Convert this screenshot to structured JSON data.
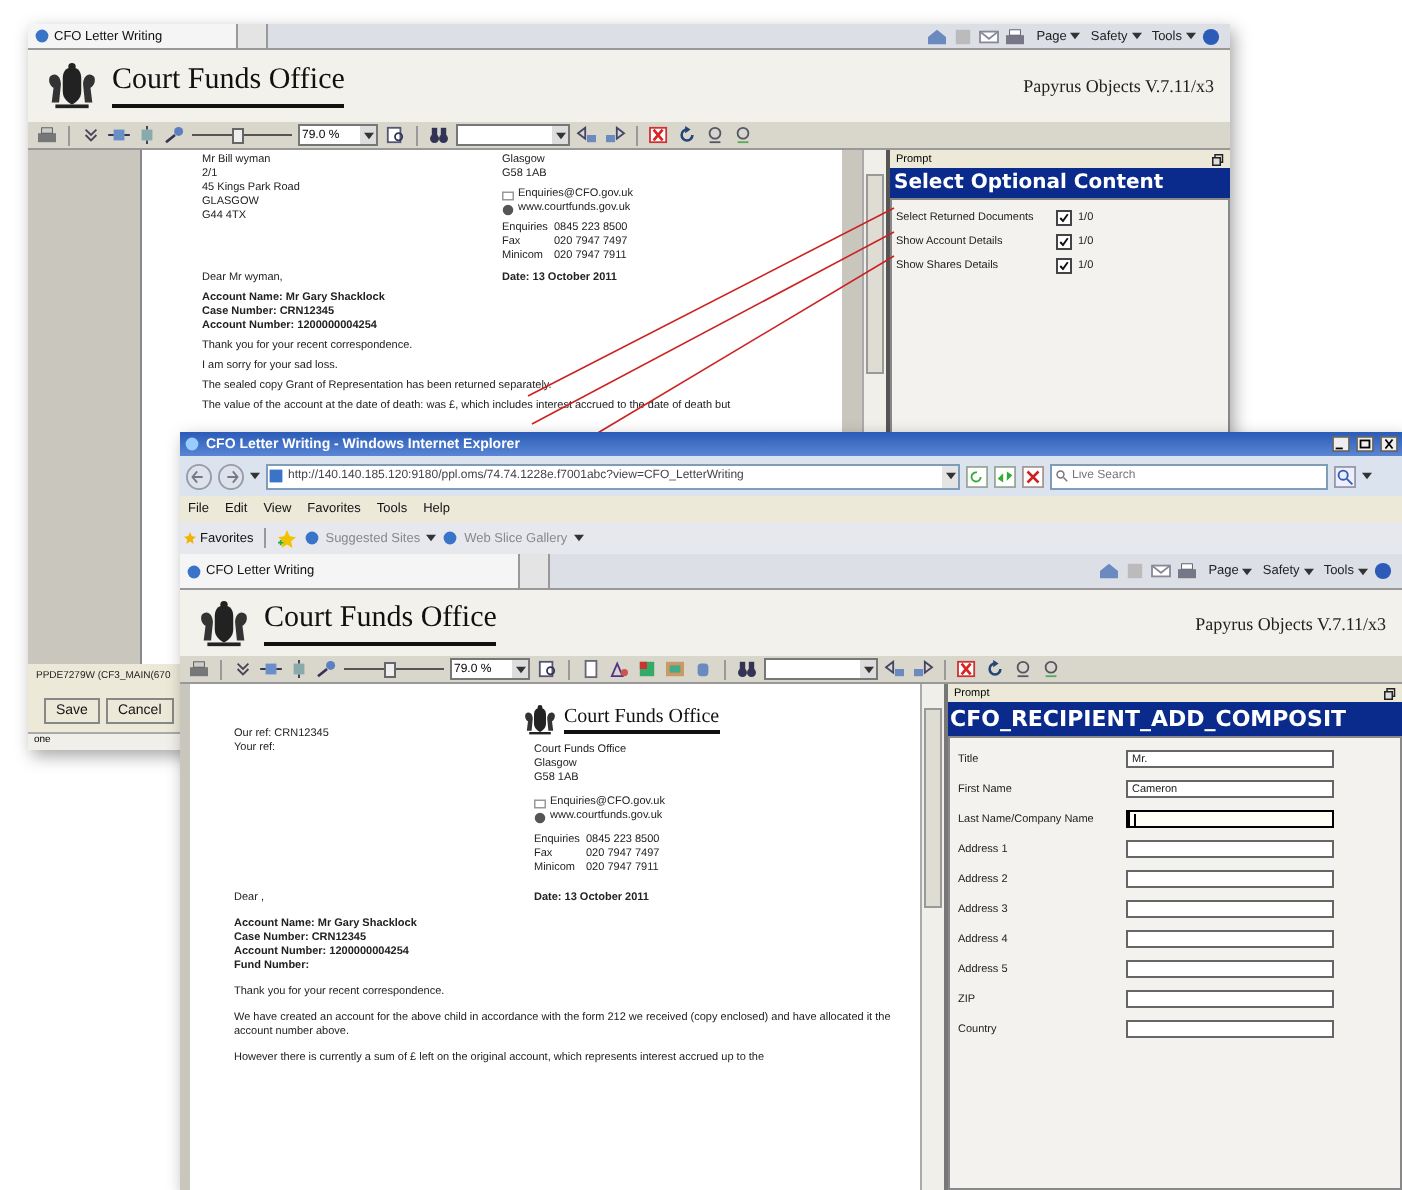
{
  "back_window": {
    "tab": "CFO Letter Writing",
    "command_bar": [
      "Page",
      "Safety",
      "Tools"
    ],
    "header": {
      "logo_text": "Court Funds Office",
      "version": "Papyrus Objects V.7.11/x3"
    },
    "toolbar": {
      "zoom": "79.0 %",
      "level": 0.45
    },
    "letter": {
      "recipient": [
        "Mr Bill wyman",
        "2/1",
        "45 Kings Park Road",
        "GLASGOW",
        "G44 4TX"
      ],
      "address": [
        "Glasgow",
        "G58 1AB"
      ],
      "email": "Enquiries@CFO.gov.uk",
      "web": "www.courtfunds.gov.uk",
      "contacts": [
        {
          "label": "Enquiries",
          "value": "0845 223 8500"
        },
        {
          "label": "Fax",
          "value": "020 7947 7497"
        },
        {
          "label": "Minicom",
          "value": "020 7947 7911"
        }
      ],
      "salutation": "Dear Mr wyman,",
      "date": "Date: 13 October 2011",
      "account_lines": [
        "Account Name: Mr Gary Shacklock",
        "Case Number: CRN12345",
        "Account Number: 1200000004254"
      ],
      "paragraphs": [
        "Thank you for your recent correspondence.",
        "I am sorry for your sad loss.",
        "The sealed copy Grant of Representation has been returned separately.",
        "The value of the account at the date of death: was £, which includes interest accrued to the date of death but"
      ]
    },
    "prompt": {
      "title": "Prompt",
      "heading": "Select Optional Content",
      "options": [
        {
          "label": "Select Returned Documents",
          "checked": true,
          "value": "1/0"
        },
        {
          "label": "Show Account Details",
          "checked": true,
          "value": "1/0"
        },
        {
          "label": "Show Shares Details",
          "checked": true,
          "value": "1/0"
        }
      ]
    },
    "status_text": "PPDE7279W (CF3_MAIN(670",
    "buttons": [
      "Save",
      "Cancel"
    ],
    "status_bar": "one"
  },
  "front_window": {
    "title": "CFO Letter Writing - Windows Internet Explorer",
    "address": "http://140.140.185.120:9180/ppl.oms/74.74.1228e.f7001abc?view=CFO_LetterWriting",
    "search_placeholder": "Live Search",
    "menu": [
      "File",
      "Edit",
      "View",
      "Favorites",
      "Tools",
      "Help"
    ],
    "favorites": {
      "label": "Favorites",
      "links": [
        "Suggested Sites",
        "Web Slice Gallery"
      ]
    },
    "tab": "CFO Letter Writing",
    "command_bar": [
      "Page",
      "Safety",
      "Tools"
    ],
    "header": {
      "logo_text": "Court Funds Office",
      "version": "Papyrus Objects V.7.11/x3"
    },
    "toolbar": {
      "zoom": "79.0 %",
      "level": 0.45
    },
    "letter": {
      "refs": [
        "Our ref: CRN12345",
        "Your ref:"
      ],
      "logo_text": "Court Funds Office",
      "address": [
        "Court Funds Office",
        "Glasgow",
        "G58 1AB"
      ],
      "email": "Enquiries@CFO.gov.uk",
      "web": "www.courtfunds.gov.uk",
      "contacts": [
        {
          "label": "Enquiries",
          "value": "0845 223 8500"
        },
        {
          "label": "Fax",
          "value": "020 7947 7497"
        },
        {
          "label": "Minicom",
          "value": "020 7947 7911"
        }
      ],
      "salutation": "Dear ,",
      "date": "Date: 13 October 2011",
      "account_lines": [
        "Account Name: Mr Gary Shacklock",
        "Case Number: CRN12345",
        "Account Number: 1200000004254",
        "Fund Number:"
      ],
      "paragraphs": [
        "Thank you for your recent correspondence.",
        "We have created an account for the above child in accordance with the form 212 we received (copy enclosed) and have allocated it the account number above.",
        "However there is currently a sum of £ left on the original account, which represents interest accrued up to the"
      ]
    },
    "prompt": {
      "title": "Prompt",
      "heading": "CFO_RECIPIENT_ADD_COMPOSIT",
      "fields": [
        {
          "label": "Title",
          "value": "Mr.",
          "focused": false
        },
        {
          "label": "First Name",
          "value": "Cameron",
          "focused": false
        },
        {
          "label": "Last Name/Company Name",
          "focused": true
        },
        {
          "label": "Address 1",
          "focused": false
        },
        {
          "label": "Address 2",
          "focused": false
        },
        {
          "label": "Address 3",
          "focused": false
        },
        {
          "label": "Address 4",
          "focused": false
        },
        {
          "label": "Address 5",
          "focused": false
        },
        {
          "label": "ZIP",
          "focused": false
        },
        {
          "label": "Country",
          "focused": false
        }
      ]
    }
  }
}
